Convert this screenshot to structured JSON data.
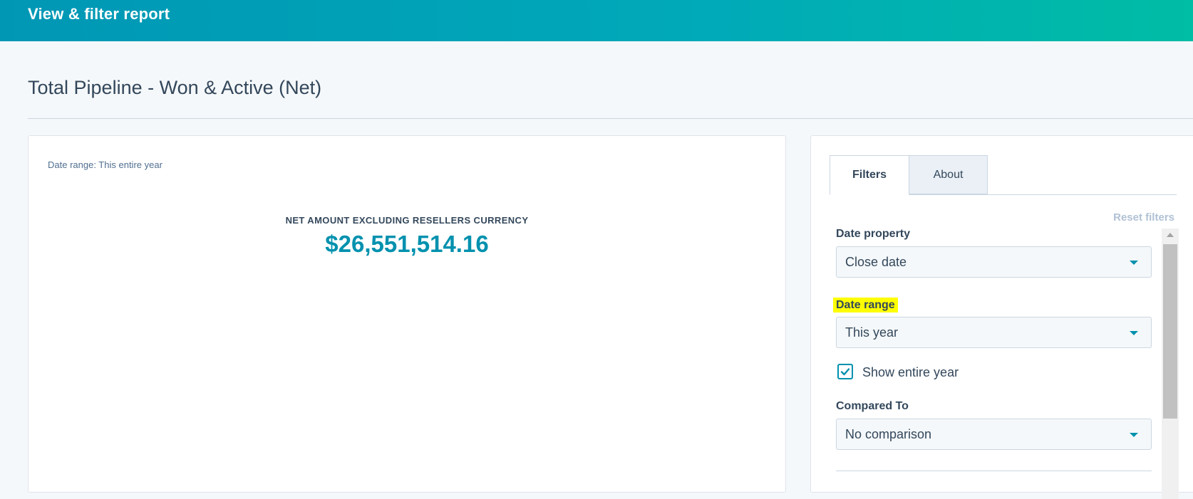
{
  "header": {
    "title": "View & filter report"
  },
  "report": {
    "title": "Total Pipeline - Won & Active (Net)"
  },
  "card": {
    "date_range_note": "Date range: This entire year",
    "metric_label": "NET AMOUNT EXCLUDING RESELLERS CURRENCY",
    "metric_value": "$26,551,514.16"
  },
  "filters_panel": {
    "tabs": [
      {
        "label": "Filters",
        "active": true
      },
      {
        "label": "About",
        "active": false
      }
    ],
    "reset_label": "Reset filters",
    "date_property": {
      "label": "Date property",
      "value": "Close date"
    },
    "date_range": {
      "label": "Date range",
      "value": "This year",
      "highlighted": true
    },
    "show_entire_year": {
      "label": "Show entire year",
      "checked": true
    },
    "compared_to": {
      "label": "Compared To",
      "value": "No comparison"
    }
  },
  "colors": {
    "accent": "#0091ae",
    "header_gradient_start": "#0097b5",
    "header_gradient_end": "#00bda5",
    "highlight": "#ffff00",
    "text": "#33475b"
  },
  "icons": {
    "dropdown": "caret-down-icon",
    "checkbox": "checkmark-icon",
    "scroll": "scroll-up-arrow-icon"
  }
}
